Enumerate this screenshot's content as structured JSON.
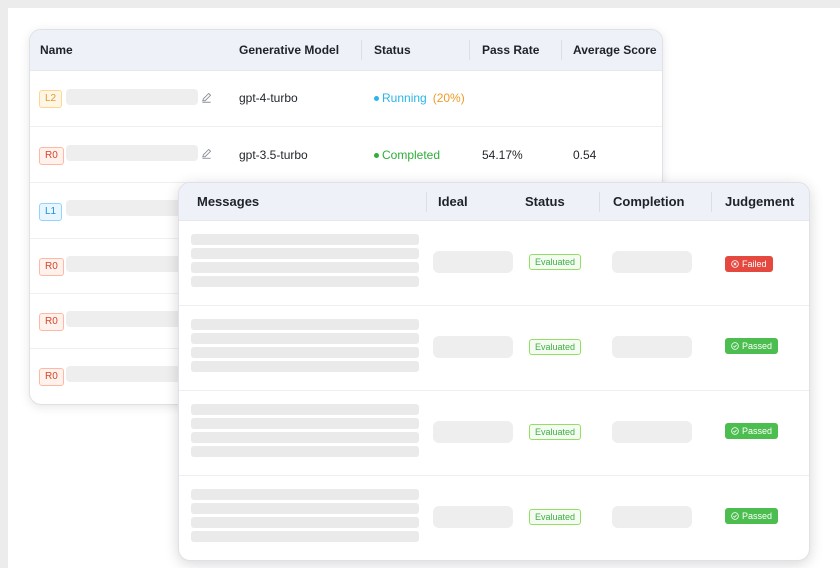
{
  "back_table": {
    "columns": [
      "Name",
      "Generative Model",
      "Status",
      "Pass Rate",
      "Average Score"
    ],
    "rows": [
      {
        "badge": "L2",
        "model": "gpt-4-turbo",
        "status": "Running",
        "progress": "(20%)",
        "pass_rate": "",
        "avg_score": ""
      },
      {
        "badge": "R0",
        "model": "gpt-3.5-turbo",
        "status": "Completed",
        "progress": "",
        "pass_rate": "54.17%",
        "avg_score": "0.54"
      },
      {
        "badge": "L1"
      },
      {
        "badge": "R0"
      },
      {
        "badge": "R0"
      },
      {
        "badge": "R0"
      }
    ]
  },
  "front_table": {
    "columns": [
      "Messages",
      "Ideal",
      "Status",
      "Completion",
      "Judgement"
    ],
    "rows": [
      {
        "status": "Evaluated",
        "judgement": "Failed"
      },
      {
        "status": "Evaluated",
        "judgement": "Passed"
      },
      {
        "status": "Evaluated",
        "judgement": "Passed"
      },
      {
        "status": "Evaluated",
        "judgement": "Passed"
      }
    ]
  },
  "icons": {
    "edit": "pencil-icon",
    "failed": "x-circle-icon",
    "passed": "check-circle-icon"
  },
  "colors": {
    "running": "#2bb5e8",
    "running_progress": "#f09a2a",
    "completed": "#2fae3a",
    "failed": "#e5483e",
    "passed": "#4cbd4f",
    "header_bg": "#eef1f8"
  }
}
